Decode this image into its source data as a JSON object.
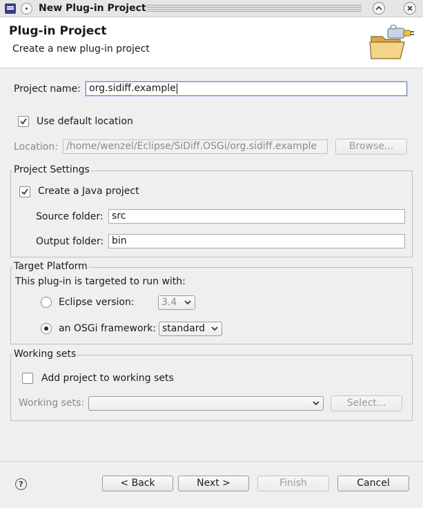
{
  "window": {
    "title": "New Plug-in Project",
    "minimize_glyph": "^",
    "close_glyph": "×"
  },
  "header": {
    "title": "Plug-in Project",
    "subtitle": "Create a new plug-in project",
    "image_icon": "plugin-folder-icon"
  },
  "project_name": {
    "label": "Project name:",
    "value": "org.sidiff.example"
  },
  "default_location": {
    "label": "Use default location",
    "checked": true
  },
  "location": {
    "label": "Location:",
    "value": "/home/wenzel/Eclipse/SiDiff.OSGi/org.sidiff.example",
    "browse_label": "Browse..."
  },
  "project_settings": {
    "title": "Project Settings",
    "java_label": "Create a Java project",
    "java_checked": true,
    "source_label": "Source folder:",
    "source_value": "src",
    "output_label": "Output folder:",
    "output_value": "bin"
  },
  "target_platform": {
    "title": "Target Platform",
    "description": "This plug-in is targeted to run with:",
    "eclipse_label": "Eclipse version:",
    "eclipse_version": "3.4",
    "osgi_label": "an OSGi framework:",
    "osgi_value": "standard",
    "selected": "osgi"
  },
  "working_sets": {
    "title": "Working sets",
    "add_label": "Add project to working sets",
    "add_checked": false,
    "sets_label": "Working sets:",
    "sets_value": "",
    "select_label": "Select..."
  },
  "footer": {
    "help_glyph": "?",
    "back_label": "< Back",
    "next_label": "Next >",
    "finish_label": "Finish",
    "cancel_label": "Cancel"
  }
}
